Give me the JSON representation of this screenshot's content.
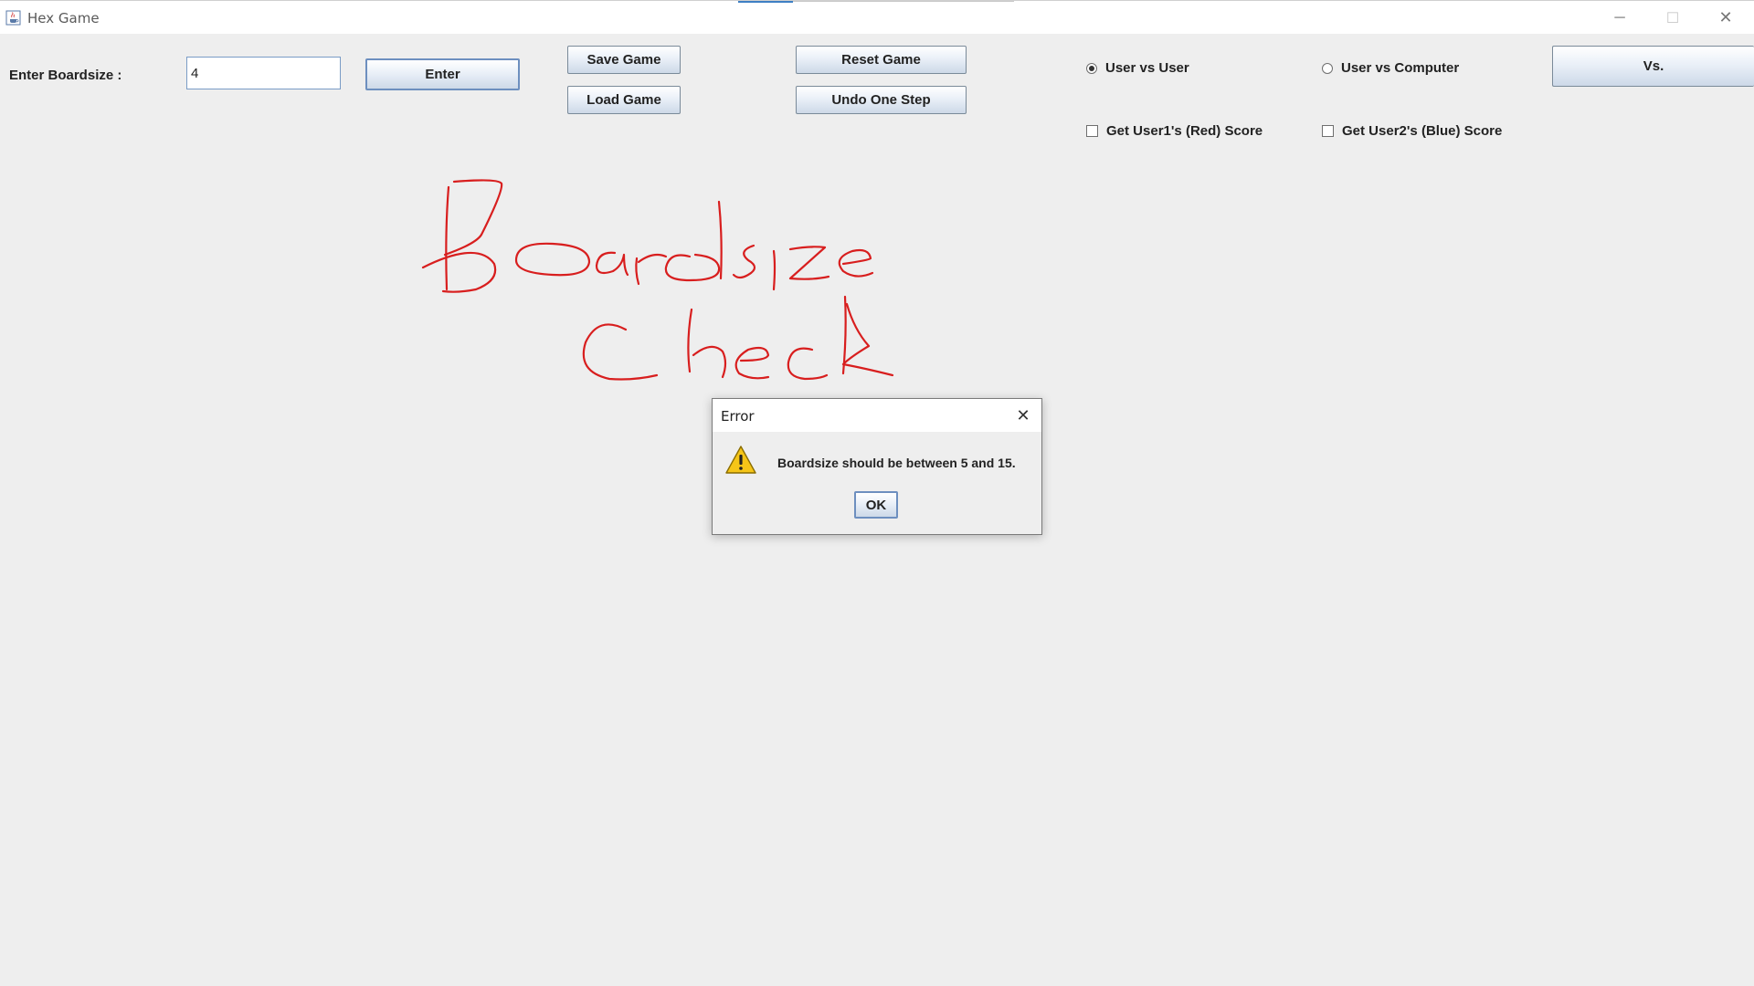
{
  "window": {
    "title": "Hex Game",
    "icon": "java-cup-icon",
    "controls": {
      "minimize": "─",
      "maximize": "☐",
      "close": "✕"
    }
  },
  "toolbar": {
    "boardsize_label": "Enter Boardsize :",
    "boardsize_value": "4",
    "enter_label": "Enter",
    "save_label": "Save Game",
    "load_label": "Load Game",
    "reset_label": "Reset Game",
    "undo_label": "Undo One Step",
    "vs_label": "Vs."
  },
  "mode": {
    "options": [
      {
        "label": "User vs User",
        "selected": true
      },
      {
        "label": "User vs Computer",
        "selected": false
      }
    ]
  },
  "scores": {
    "user1_label": "Get User1's (Red) Score",
    "user1_checked": false,
    "user2_label": "Get User2's (Blue) Score",
    "user2_checked": false
  },
  "annotation": {
    "line1": "Boardsize",
    "line2": "Check",
    "color": "#d81e1e"
  },
  "dialog": {
    "title": "Error",
    "icon": "warning-icon",
    "message": "Boardsize should be between 5 and 15.",
    "ok_label": "OK",
    "close": "✕"
  },
  "colors": {
    "background": "#eeeeee",
    "warning_fill": "#f5c518",
    "focus_border": "#6d8fbf"
  }
}
